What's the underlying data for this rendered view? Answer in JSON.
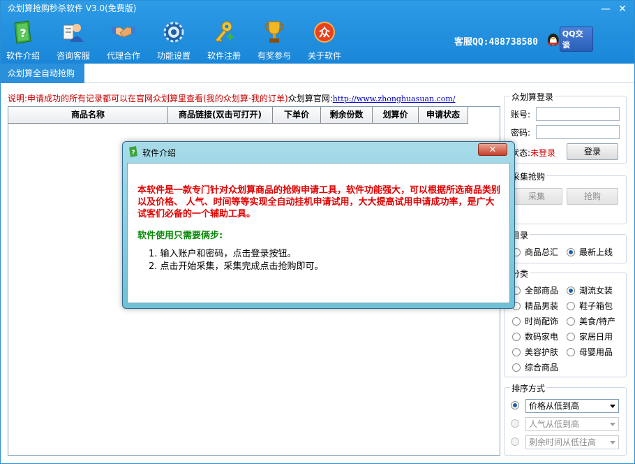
{
  "window": {
    "title": "众划算抢购秒杀软件 V3.0(免费版)",
    "min_icon": "minimize-icon",
    "close_icon": "close-icon",
    "min_symbol": "—",
    "close_symbol": "✕"
  },
  "toolbar": [
    {
      "label": "软件介绍",
      "icon": "book-help-icon"
    },
    {
      "label": "咨询客服",
      "icon": "customer-service-icon"
    },
    {
      "label": "代理合作",
      "icon": "handshake-icon"
    },
    {
      "label": "功能设置",
      "icon": "settings-gear-icon"
    },
    {
      "label": "软件注册",
      "icon": "key-add-icon"
    },
    {
      "label": "有奖参与",
      "icon": "trophy-icon"
    },
    {
      "label": "关于软件",
      "icon": "logo-badge-icon"
    }
  ],
  "support": {
    "text": "客服QQ:488738580",
    "qq_button": "QQ交谈"
  },
  "logo_char": "众",
  "tab": {
    "label": "众划算全自动抢购"
  },
  "note": {
    "prefix": "说明:申请成功的所有记录都可以在官网众划算里查看(我的众划算-我的订单)",
    "site_label": "众划算官网:",
    "url": "http://www.zhonghuasuan.com/"
  },
  "grid": {
    "columns": [
      "商品名称",
      "商品链接(双击可打开)",
      "下单价",
      "剩余份数",
      "划算价",
      "申请状态"
    ]
  },
  "login": {
    "group": "众划算登录",
    "account_label": "账号:",
    "password_label": "密码:",
    "status_label": "状态:",
    "status_value": "未登录",
    "login_button": "登录"
  },
  "collect": {
    "group": "采集抢购",
    "collect_button": "采集",
    "grab_button": "抢购"
  },
  "catalog": {
    "group": "目录",
    "options": [
      {
        "label": "商品总汇",
        "checked": false
      },
      {
        "label": "最新上线",
        "checked": true
      }
    ]
  },
  "category": {
    "group": "分类",
    "options": [
      {
        "label": "全部商品",
        "checked": false
      },
      {
        "label": "潮流女装",
        "checked": true
      },
      {
        "label": "精品男装",
        "checked": false
      },
      {
        "label": "鞋子箱包",
        "checked": false
      },
      {
        "label": "时尚配饰",
        "checked": false
      },
      {
        "label": "美食/特产",
        "checked": false
      },
      {
        "label": "数码家电",
        "checked": false
      },
      {
        "label": "家居日用",
        "checked": false
      },
      {
        "label": "美容护肤",
        "checked": false
      },
      {
        "label": "母婴用品",
        "checked": false
      },
      {
        "label": "综合商品",
        "checked": false
      }
    ]
  },
  "sort": {
    "group": "排序方式",
    "options": [
      {
        "value": "价格从低到高",
        "checked": true,
        "enabled": true
      },
      {
        "value": "人气从低到高",
        "checked": false,
        "enabled": false
      },
      {
        "value": "剩余时间从低往高",
        "checked": false,
        "enabled": false
      }
    ]
  },
  "dialog": {
    "title": "软件介绍",
    "close_symbol": "✕",
    "description": "本软件是一款专门针对众划算商品的抢购申请工具，软件功能强大，可以根据所选商品类别以及价格、 人气、时间等等实现全自动挂机申请试用，大大提高试用申请成功率，是广大试客们必备的一个辅助工具。",
    "steps_title": "软件使用只需要俩步:",
    "steps": [
      "1.  输入账户和密码，点击登录按钮。",
      "2.  点击开始采集，采集完成点击抢购即可。"
    ]
  }
}
